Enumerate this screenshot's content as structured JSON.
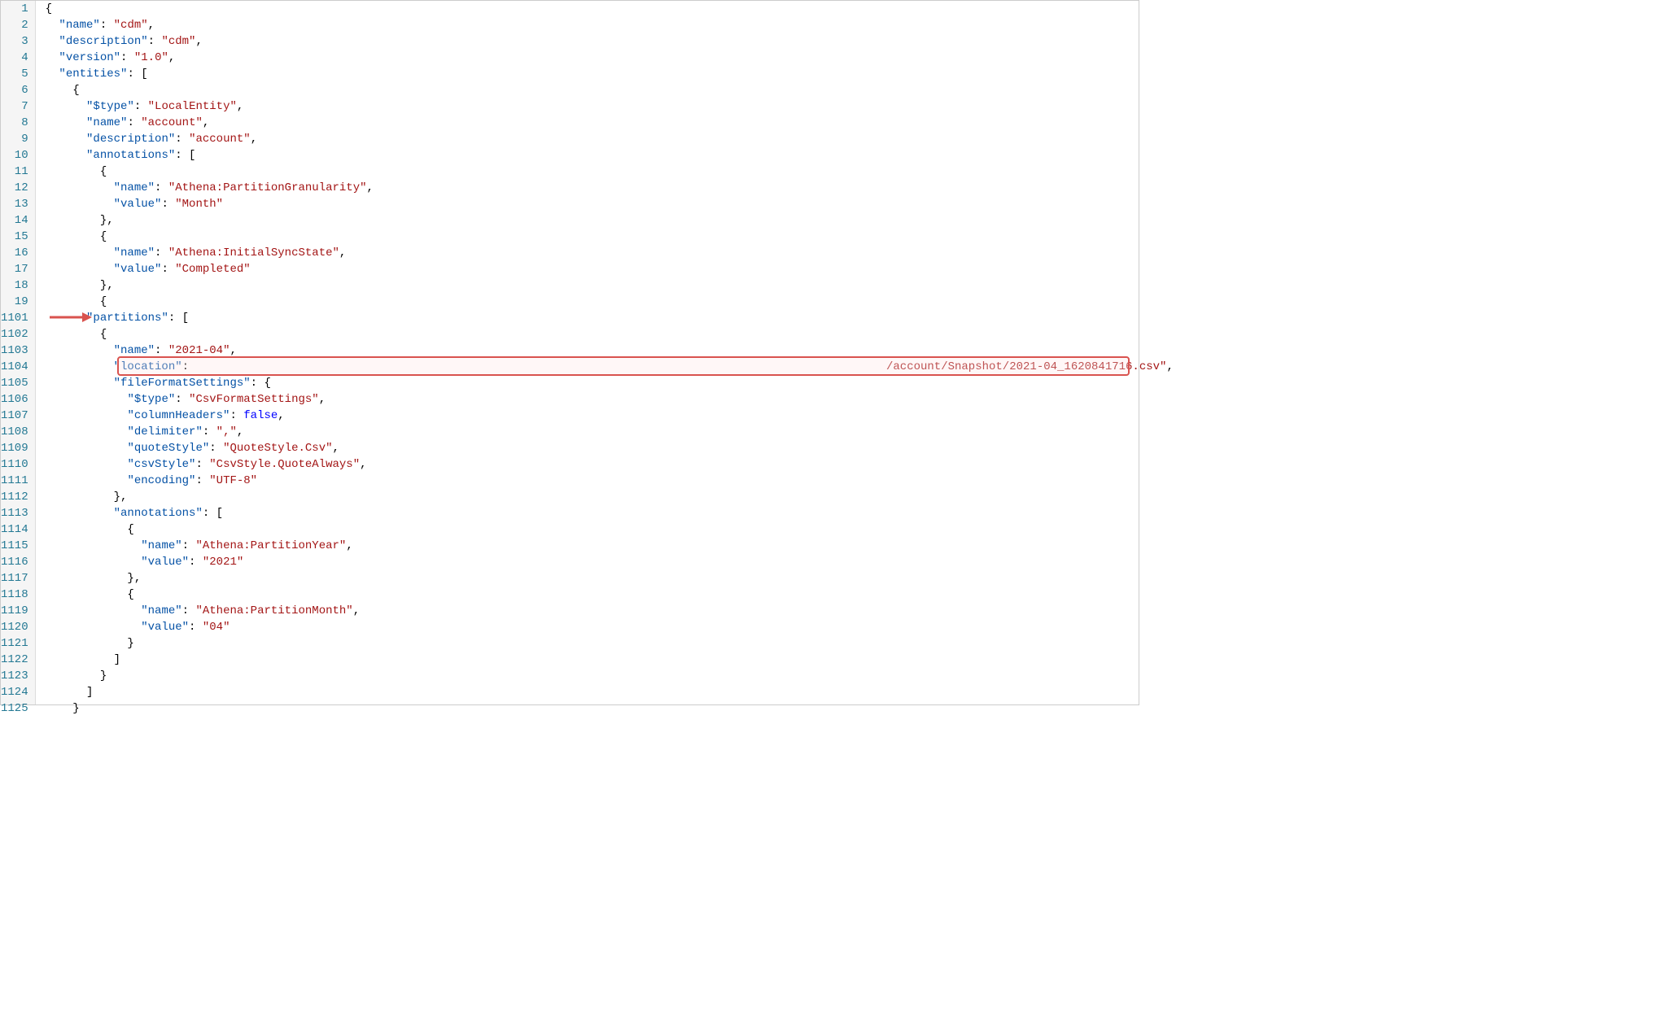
{
  "lineNumbers": [
    "1",
    "2",
    "3",
    "4",
    "5",
    "6",
    "7",
    "8",
    "9",
    "10",
    "11",
    "12",
    "13",
    "14",
    "15",
    "16",
    "17",
    "18",
    "19",
    "1101",
    "1102",
    "1103",
    "1104",
    "1105",
    "1106",
    "1107",
    "1108",
    "1109",
    "1110",
    "1111",
    "1112",
    "1113",
    "1114",
    "1115",
    "1116",
    "1117",
    "1118",
    "1119",
    "1120",
    "1121",
    "1122",
    "1123",
    "1124",
    "1125"
  ],
  "code": {
    "1": [
      {
        "t": "p",
        "v": "{"
      }
    ],
    "2": [
      {
        "t": "p",
        "v": "  "
      },
      {
        "t": "k",
        "v": "\"name\""
      },
      {
        "t": "p",
        "v": ": "
      },
      {
        "t": "s",
        "v": "\"cdm\""
      },
      {
        "t": "p",
        "v": ","
      }
    ],
    "3": [
      {
        "t": "p",
        "v": "  "
      },
      {
        "t": "k",
        "v": "\"description\""
      },
      {
        "t": "p",
        "v": ": "
      },
      {
        "t": "s",
        "v": "\"cdm\""
      },
      {
        "t": "p",
        "v": ","
      }
    ],
    "4": [
      {
        "t": "p",
        "v": "  "
      },
      {
        "t": "k",
        "v": "\"version\""
      },
      {
        "t": "p",
        "v": ": "
      },
      {
        "t": "s",
        "v": "\"1.0\""
      },
      {
        "t": "p",
        "v": ","
      }
    ],
    "5": [
      {
        "t": "p",
        "v": "  "
      },
      {
        "t": "k",
        "v": "\"entities\""
      },
      {
        "t": "p",
        "v": ": ["
      }
    ],
    "6": [
      {
        "t": "p",
        "v": "    {"
      }
    ],
    "7": [
      {
        "t": "p",
        "v": "      "
      },
      {
        "t": "k",
        "v": "\"$type\""
      },
      {
        "t": "p",
        "v": ": "
      },
      {
        "t": "s",
        "v": "\"LocalEntity\""
      },
      {
        "t": "p",
        "v": ","
      }
    ],
    "8": [
      {
        "t": "p",
        "v": "      "
      },
      {
        "t": "k",
        "v": "\"name\""
      },
      {
        "t": "p",
        "v": ": "
      },
      {
        "t": "s",
        "v": "\"account\""
      },
      {
        "t": "p",
        "v": ","
      }
    ],
    "9": [
      {
        "t": "p",
        "v": "      "
      },
      {
        "t": "k",
        "v": "\"description\""
      },
      {
        "t": "p",
        "v": ": "
      },
      {
        "t": "s",
        "v": "\"account\""
      },
      {
        "t": "p",
        "v": ","
      }
    ],
    "10": [
      {
        "t": "p",
        "v": "      "
      },
      {
        "t": "k",
        "v": "\"annotations\""
      },
      {
        "t": "p",
        "v": ": ["
      }
    ],
    "11": [
      {
        "t": "p",
        "v": "        {"
      }
    ],
    "12": [
      {
        "t": "p",
        "v": "          "
      },
      {
        "t": "k",
        "v": "\"name\""
      },
      {
        "t": "p",
        "v": ": "
      },
      {
        "t": "s",
        "v": "\"Athena:PartitionGranularity\""
      },
      {
        "t": "p",
        "v": ","
      }
    ],
    "13": [
      {
        "t": "p",
        "v": "          "
      },
      {
        "t": "k",
        "v": "\"value\""
      },
      {
        "t": "p",
        "v": ": "
      },
      {
        "t": "s",
        "v": "\"Month\""
      }
    ],
    "14": [
      {
        "t": "p",
        "v": "        },"
      }
    ],
    "15": [
      {
        "t": "p",
        "v": "        {"
      }
    ],
    "16": [
      {
        "t": "p",
        "v": "          "
      },
      {
        "t": "k",
        "v": "\"name\""
      },
      {
        "t": "p",
        "v": ": "
      },
      {
        "t": "s",
        "v": "\"Athena:InitialSyncState\""
      },
      {
        "t": "p",
        "v": ","
      }
    ],
    "17": [
      {
        "t": "p",
        "v": "          "
      },
      {
        "t": "k",
        "v": "\"value\""
      },
      {
        "t": "p",
        "v": ": "
      },
      {
        "t": "s",
        "v": "\"Completed\""
      }
    ],
    "18": [
      {
        "t": "p",
        "v": "        },"
      }
    ],
    "19": [
      {
        "t": "p",
        "v": "        {"
      }
    ],
    "1101": [
      {
        "t": "p",
        "v": "      "
      },
      {
        "t": "k",
        "v": "\"partitions\""
      },
      {
        "t": "p",
        "v": ": ["
      }
    ],
    "1102": [
      {
        "t": "p",
        "v": "        {"
      }
    ],
    "1103": [
      {
        "t": "p",
        "v": "          "
      },
      {
        "t": "k",
        "v": "\"name\""
      },
      {
        "t": "p",
        "v": ": "
      },
      {
        "t": "s",
        "v": "\"2021-04\""
      },
      {
        "t": "p",
        "v": ","
      }
    ],
    "1104": [
      {
        "t": "p",
        "v": "          "
      },
      {
        "t": "k",
        "v": "\"location\""
      },
      {
        "t": "p",
        "v": ":                                                                                                      "
      },
      {
        "t": "s",
        "v": "/account/Snapshot/2021-04_1620841716.csv\""
      },
      {
        "t": "p",
        "v": ","
      }
    ],
    "1105": [
      {
        "t": "p",
        "v": "          "
      },
      {
        "t": "k",
        "v": "\"fileFormatSettings\""
      },
      {
        "t": "p",
        "v": ": {"
      }
    ],
    "1106": [
      {
        "t": "p",
        "v": "            "
      },
      {
        "t": "k",
        "v": "\"$type\""
      },
      {
        "t": "p",
        "v": ": "
      },
      {
        "t": "s",
        "v": "\"CsvFormatSettings\""
      },
      {
        "t": "p",
        "v": ","
      }
    ],
    "1107": [
      {
        "t": "p",
        "v": "            "
      },
      {
        "t": "k",
        "v": "\"columnHeaders\""
      },
      {
        "t": "p",
        "v": ": "
      },
      {
        "t": "b",
        "v": "false"
      },
      {
        "t": "p",
        "v": ","
      }
    ],
    "1108": [
      {
        "t": "p",
        "v": "            "
      },
      {
        "t": "k",
        "v": "\"delimiter\""
      },
      {
        "t": "p",
        "v": ": "
      },
      {
        "t": "s",
        "v": "\",\""
      },
      {
        "t": "p",
        "v": ","
      }
    ],
    "1109": [
      {
        "t": "p",
        "v": "            "
      },
      {
        "t": "k",
        "v": "\"quoteStyle\""
      },
      {
        "t": "p",
        "v": ": "
      },
      {
        "t": "s",
        "v": "\"QuoteStyle.Csv\""
      },
      {
        "t": "p",
        "v": ","
      }
    ],
    "1110": [
      {
        "t": "p",
        "v": "            "
      },
      {
        "t": "k",
        "v": "\"csvStyle\""
      },
      {
        "t": "p",
        "v": ": "
      },
      {
        "t": "s",
        "v": "\"CsvStyle.QuoteAlways\""
      },
      {
        "t": "p",
        "v": ","
      }
    ],
    "1111": [
      {
        "t": "p",
        "v": "            "
      },
      {
        "t": "k",
        "v": "\"encoding\""
      },
      {
        "t": "p",
        "v": ": "
      },
      {
        "t": "s",
        "v": "\"UTF-8\""
      }
    ],
    "1112": [
      {
        "t": "p",
        "v": "          },"
      }
    ],
    "1113": [
      {
        "t": "p",
        "v": "          "
      },
      {
        "t": "k",
        "v": "\"annotations\""
      },
      {
        "t": "p",
        "v": ": ["
      }
    ],
    "1114": [
      {
        "t": "p",
        "v": "            {"
      }
    ],
    "1115": [
      {
        "t": "p",
        "v": "              "
      },
      {
        "t": "k",
        "v": "\"name\""
      },
      {
        "t": "p",
        "v": ": "
      },
      {
        "t": "s",
        "v": "\"Athena:PartitionYear\""
      },
      {
        "t": "p",
        "v": ","
      }
    ],
    "1116": [
      {
        "t": "p",
        "v": "              "
      },
      {
        "t": "k",
        "v": "\"value\""
      },
      {
        "t": "p",
        "v": ": "
      },
      {
        "t": "s",
        "v": "\"2021\""
      }
    ],
    "1117": [
      {
        "t": "p",
        "v": "            },"
      }
    ],
    "1118": [
      {
        "t": "p",
        "v": "            {"
      }
    ],
    "1119": [
      {
        "t": "p",
        "v": "              "
      },
      {
        "t": "k",
        "v": "\"name\""
      },
      {
        "t": "p",
        "v": ": "
      },
      {
        "t": "s",
        "v": "\"Athena:PartitionMonth\""
      },
      {
        "t": "p",
        "v": ","
      }
    ],
    "1120": [
      {
        "t": "p",
        "v": "              "
      },
      {
        "t": "k",
        "v": "\"value\""
      },
      {
        "t": "p",
        "v": ": "
      },
      {
        "t": "s",
        "v": "\"04\""
      }
    ],
    "1121": [
      {
        "t": "p",
        "v": "            }"
      }
    ],
    "1122": [
      {
        "t": "p",
        "v": "          ]"
      }
    ],
    "1123": [
      {
        "t": "p",
        "v": "        }"
      }
    ],
    "1124": [
      {
        "t": "p",
        "v": "      ]"
      }
    ],
    "1125": [
      {
        "t": "p",
        "v": "    }"
      }
    ]
  },
  "annotation": {
    "arrowColor": "#d9534f",
    "boxColor": "#d9534f"
  }
}
